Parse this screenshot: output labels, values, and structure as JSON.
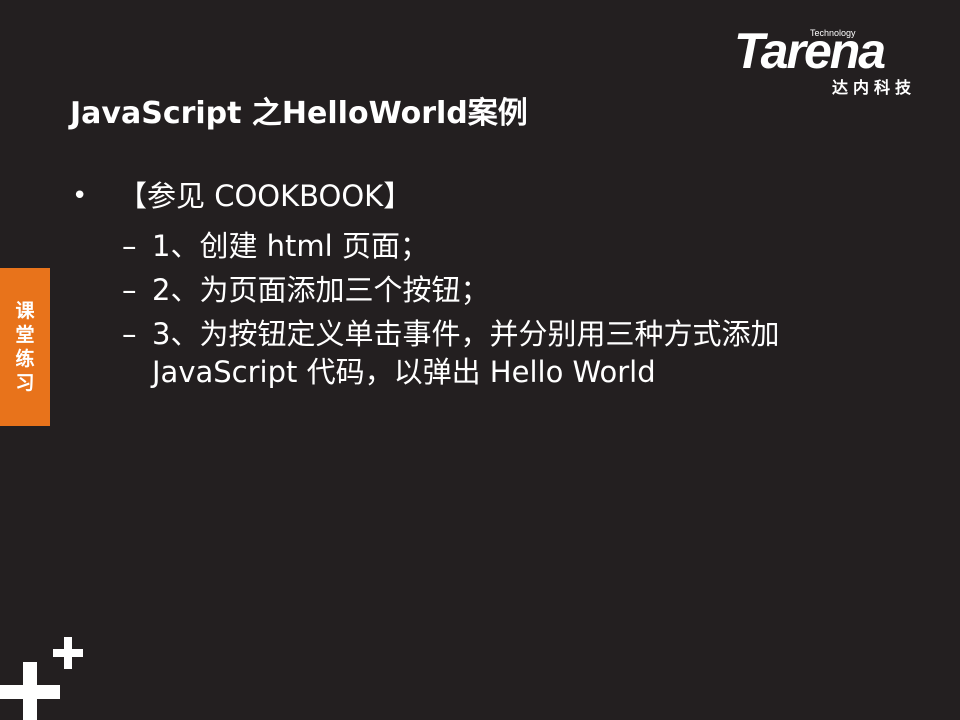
{
  "logo": {
    "tech": "Technology",
    "word": "Tarena",
    "cn": "达内科技"
  },
  "title": "JavaScript 之HelloWorld案例",
  "bullet": {
    "marker": "•",
    "text": "【参见 COOKBOOK】"
  },
  "sub_items": [
    {
      "dash": "–",
      "text": "1、创建 html 页面；",
      "cont": ""
    },
    {
      "dash": "–",
      "text": "2、为页面添加三个按钮；",
      "cont": ""
    },
    {
      "dash": "–",
      "text": "3、为按钮定义单击事件，并分别用三种方式添加",
      "cont": "JavaScript 代码，以弹出 Hello World"
    }
  ],
  "side_tab": [
    "课",
    "堂",
    "练",
    "习"
  ],
  "colors": {
    "background": "#231f20",
    "accent": "#e8731b",
    "text": "#ffffff"
  },
  "decorations": {
    "plus_icon": "plus-icon"
  }
}
